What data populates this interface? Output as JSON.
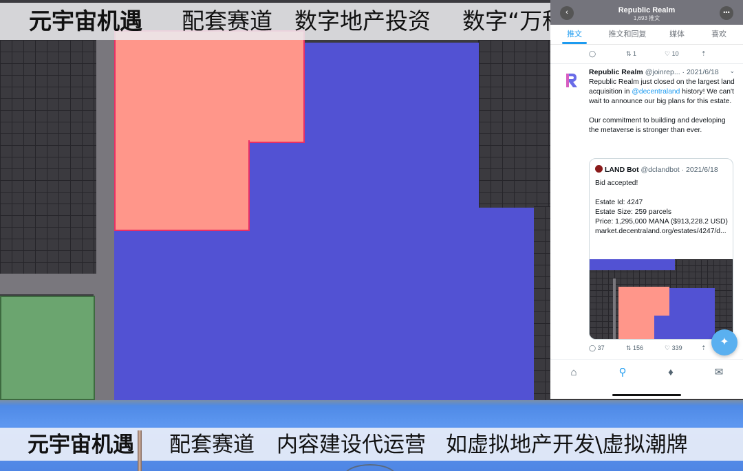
{
  "top_banner": {
    "brand": "元宇宙机遇",
    "item1": "配套赛道",
    "item2": "数字地产投资",
    "item3": "数字“万科”"
  },
  "map": {
    "colors": {
      "estate": "#5252d3",
      "acquired": "#ff968a",
      "border": "#ea2f64",
      "parcel": "#6ba56f",
      "road": "#79777d"
    }
  },
  "profile": {
    "name": "Republic Realm",
    "tweet_count": "1,693 推文",
    "tabs": [
      "推文",
      "推文和回复",
      "媒体",
      "喜欢"
    ]
  },
  "prev_actions": {
    "retweets": "1",
    "likes": "10"
  },
  "tweet": {
    "name": "Republic Realm",
    "handle_date": "@joinrep... · 2021/6/18",
    "para1_before": "Republic Realm just closed on the largest land acquisition in ",
    "mention": "@decentraland",
    "para1_after": " history! We can't wait to announce our big plans for this estate.",
    "para2": "Our commitment to building and developing the metaverse is stronger than ever.",
    "quote": {
      "name": "LAND Bot",
      "handle_date": "@dclandbot · 2021/6/18",
      "line1": "Bid accepted!",
      "line2": "Estate Id: 4247",
      "line3": "Estate Size: 259 parcels",
      "line4": "Price: 1,295,000 MANA ($913,228.2 USD)",
      "line5": "market.decentraland.org/estates/4247/d..."
    },
    "replies": "37",
    "retweets": "156",
    "likes": "339"
  },
  "nav_icons": [
    "home-icon",
    "search-icon",
    "bell-icon",
    "mail-icon"
  ],
  "bottom_banner": {
    "brand": "元宇宙机遇",
    "item1": "配套赛道",
    "item2": "内容建设代运营",
    "item3": "如虚拟地产开发\\虚拟潮牌"
  }
}
